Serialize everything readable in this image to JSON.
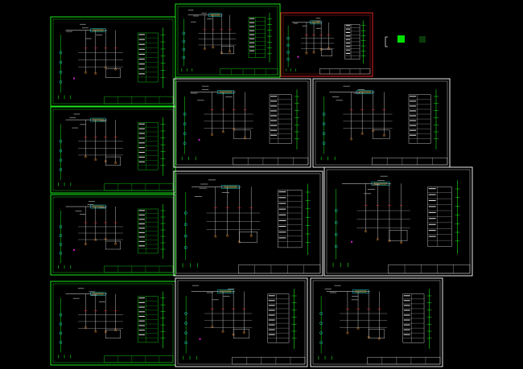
{
  "canvas": {
    "background": "#000000",
    "page_title": ""
  },
  "palette": {
    "green": "#18e818",
    "white": "#e8e8e8",
    "cyan": "#20d8d8",
    "yellow": "#e8e020",
    "orange": "#e08020",
    "red": "#e02020",
    "magenta": "#d020d0",
    "gray": "#909090"
  },
  "sheets": [
    {
      "id": "sheet-1",
      "color": "green",
      "style": "panel-a"
    },
    {
      "id": "sheet-2",
      "color": "green",
      "style": "panel-b"
    },
    {
      "id": "sheet-3",
      "color": "red",
      "style": "panel-c"
    },
    {
      "id": "sheet-4",
      "color": "green",
      "style": "panel-d"
    },
    {
      "id": "sheet-5",
      "color": "white",
      "style": "panel-e"
    },
    {
      "id": "sheet-6",
      "color": "white",
      "style": "panel-e"
    },
    {
      "id": "sheet-7",
      "color": "green",
      "style": "panel-f"
    },
    {
      "id": "sheet-8",
      "color": "white",
      "style": "panel-g"
    },
    {
      "id": "sheet-9",
      "color": "white",
      "style": "panel-g"
    },
    {
      "id": "sheet-10",
      "color": "green",
      "style": "panel-f"
    },
    {
      "id": "sheet-11",
      "color": "white",
      "style": "panel-h"
    },
    {
      "id": "sheet-12",
      "color": "white",
      "style": "panel-h"
    }
  ],
  "legend_swatches": [
    {
      "color": "#00e000"
    },
    {
      "color": "#0a3a0a"
    }
  ]
}
